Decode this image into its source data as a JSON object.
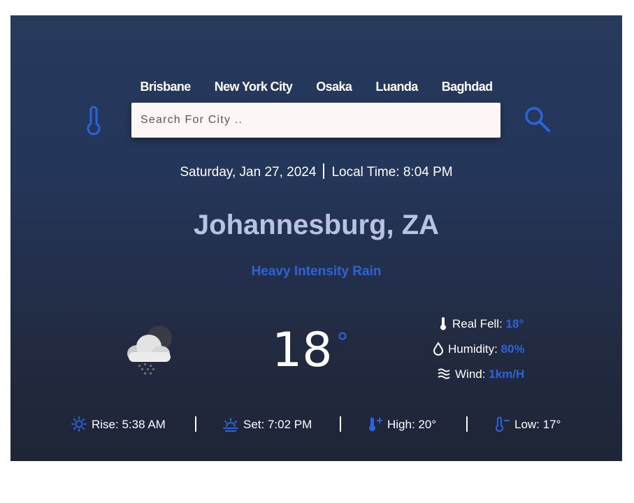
{
  "nav": {
    "cities": [
      "Brisbane",
      "New York City",
      "Osaka",
      "Luanda",
      "Baghdad"
    ]
  },
  "search": {
    "placeholder": "Search For City ..",
    "value": ""
  },
  "datetime": {
    "date": "Saturday, Jan 27, 2024",
    "local_time": "Local Time: 8:04 PM"
  },
  "location": "Johannesburg, ZA",
  "condition": "Heavy Intensity Rain",
  "current": {
    "temp": "18",
    "degree_symbol": "°"
  },
  "details": {
    "real_feel_label": "Real Fell:",
    "real_feel_value": "18°",
    "humidity_label": "Humidity:",
    "humidity_value": "80%",
    "wind_label": "Wind:",
    "wind_value": "1km/H"
  },
  "sun_stats": {
    "rise": "Rise: 5:38 AM",
    "set": "Set: 7:02 PM",
    "high": "High: 20°",
    "low": "Low: 17°"
  },
  "colors": {
    "accent": "#2b63db",
    "city_name": "#b7c3e0",
    "search_bg": "#fdf6f6"
  },
  "icons": [
    "thermometer-icon",
    "search-icon",
    "weather-rain-cloud-icon",
    "thermometer-small-icon",
    "droplet-icon",
    "wind-icon",
    "sunrise-icon",
    "sunset-icon",
    "temp-high-icon",
    "temp-low-icon"
  ]
}
